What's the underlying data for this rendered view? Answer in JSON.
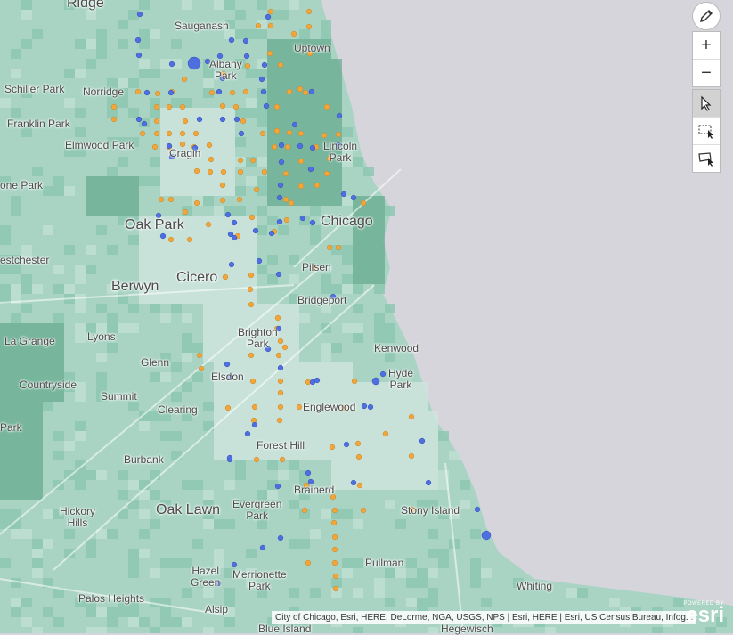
{
  "map": {
    "land_color": "#a9d4c4",
    "water_color": "#d6d5dc",
    "light_color": "#cfe5de",
    "dark_color": "#4f9a7b",
    "orange_point_color": "#f0a63a",
    "blue_point_color": "#4f6fe0",
    "places": [
      {
        "name": "Ridge",
        "size": "lg"
      },
      {
        "name": "Sauganash",
        "size": "sm"
      },
      {
        "name": "Uptown",
        "size": "sm"
      },
      {
        "name": "Albany\nPark",
        "size": "sm"
      },
      {
        "name": "Schiller Park",
        "size": "sm"
      },
      {
        "name": "Norridge",
        "size": "sm"
      },
      {
        "name": "Franklin Park",
        "size": "sm"
      },
      {
        "name": "Elmwood Park",
        "size": "sm"
      },
      {
        "name": "Cragin",
        "size": "sm"
      },
      {
        "name": "Lincoln\nPark",
        "size": "sm"
      },
      {
        "name": "one Park",
        "size": "sm"
      },
      {
        "name": "Oak Park",
        "size": "lg"
      },
      {
        "name": "Chicago",
        "size": "lg"
      },
      {
        "name": "estchester",
        "size": "sm"
      },
      {
        "name": "Berwyn",
        "size": "lg"
      },
      {
        "name": "Cicero",
        "size": "lg"
      },
      {
        "name": "Pilsen",
        "size": "sm"
      },
      {
        "name": "Bridgeport",
        "size": "sm"
      },
      {
        "name": "La Grange",
        "size": "sm"
      },
      {
        "name": "Lyons",
        "size": "sm"
      },
      {
        "name": "Brighton\nPark",
        "size": "sm"
      },
      {
        "name": "Kenwood",
        "size": "sm"
      },
      {
        "name": "Glenn",
        "size": "sm"
      },
      {
        "name": "Countryside",
        "size": "sm"
      },
      {
        "name": "Summit",
        "size": "sm"
      },
      {
        "name": "Elsdon",
        "size": "sm"
      },
      {
        "name": "Hyde\nPark",
        "size": "sm"
      },
      {
        "name": "Clearing",
        "size": "sm"
      },
      {
        "name": "Englewood",
        "size": "sm"
      },
      {
        "name": "Park",
        "size": "sm"
      },
      {
        "name": "Forest Hill",
        "size": "sm"
      },
      {
        "name": "Burbank",
        "size": "sm"
      },
      {
        "name": "Brainerd",
        "size": "sm"
      },
      {
        "name": "Hickory\nHills",
        "size": "sm"
      },
      {
        "name": "Oak Lawn",
        "size": "lg"
      },
      {
        "name": "Evergreen\nPark",
        "size": "sm"
      },
      {
        "name": "Stony Island",
        "size": "sm"
      },
      {
        "name": "Hazel\nGreen",
        "size": "sm"
      },
      {
        "name": "Merrionette\nPark",
        "size": "sm"
      },
      {
        "name": "Pullman",
        "size": "sm"
      },
      {
        "name": "Whiting",
        "size": "sm"
      },
      {
        "name": "Palos Heights",
        "size": "sm"
      },
      {
        "name": "Alsip",
        "size": "sm"
      },
      {
        "name": "Blue Island",
        "size": "sm"
      },
      {
        "name": "Hegewisch",
        "size": "sm"
      }
    ]
  },
  "toolbar": {
    "pencil_icon": "pencil-icon",
    "zoom_in_label": "+",
    "zoom_out_label": "−",
    "select_icon": "pointer-icon",
    "rect_select_icon": "rectangle-select-icon",
    "lasso_select_icon": "lasso-select-icon"
  },
  "attribution": "City of Chicago, Esri, HERE, DeLorme, NGA, USGS, NPS | Esri, HERE | Esri, US Census Bureau, Infog...",
  "logo": {
    "powered_by": "POWERED BY",
    "name": "esri"
  }
}
